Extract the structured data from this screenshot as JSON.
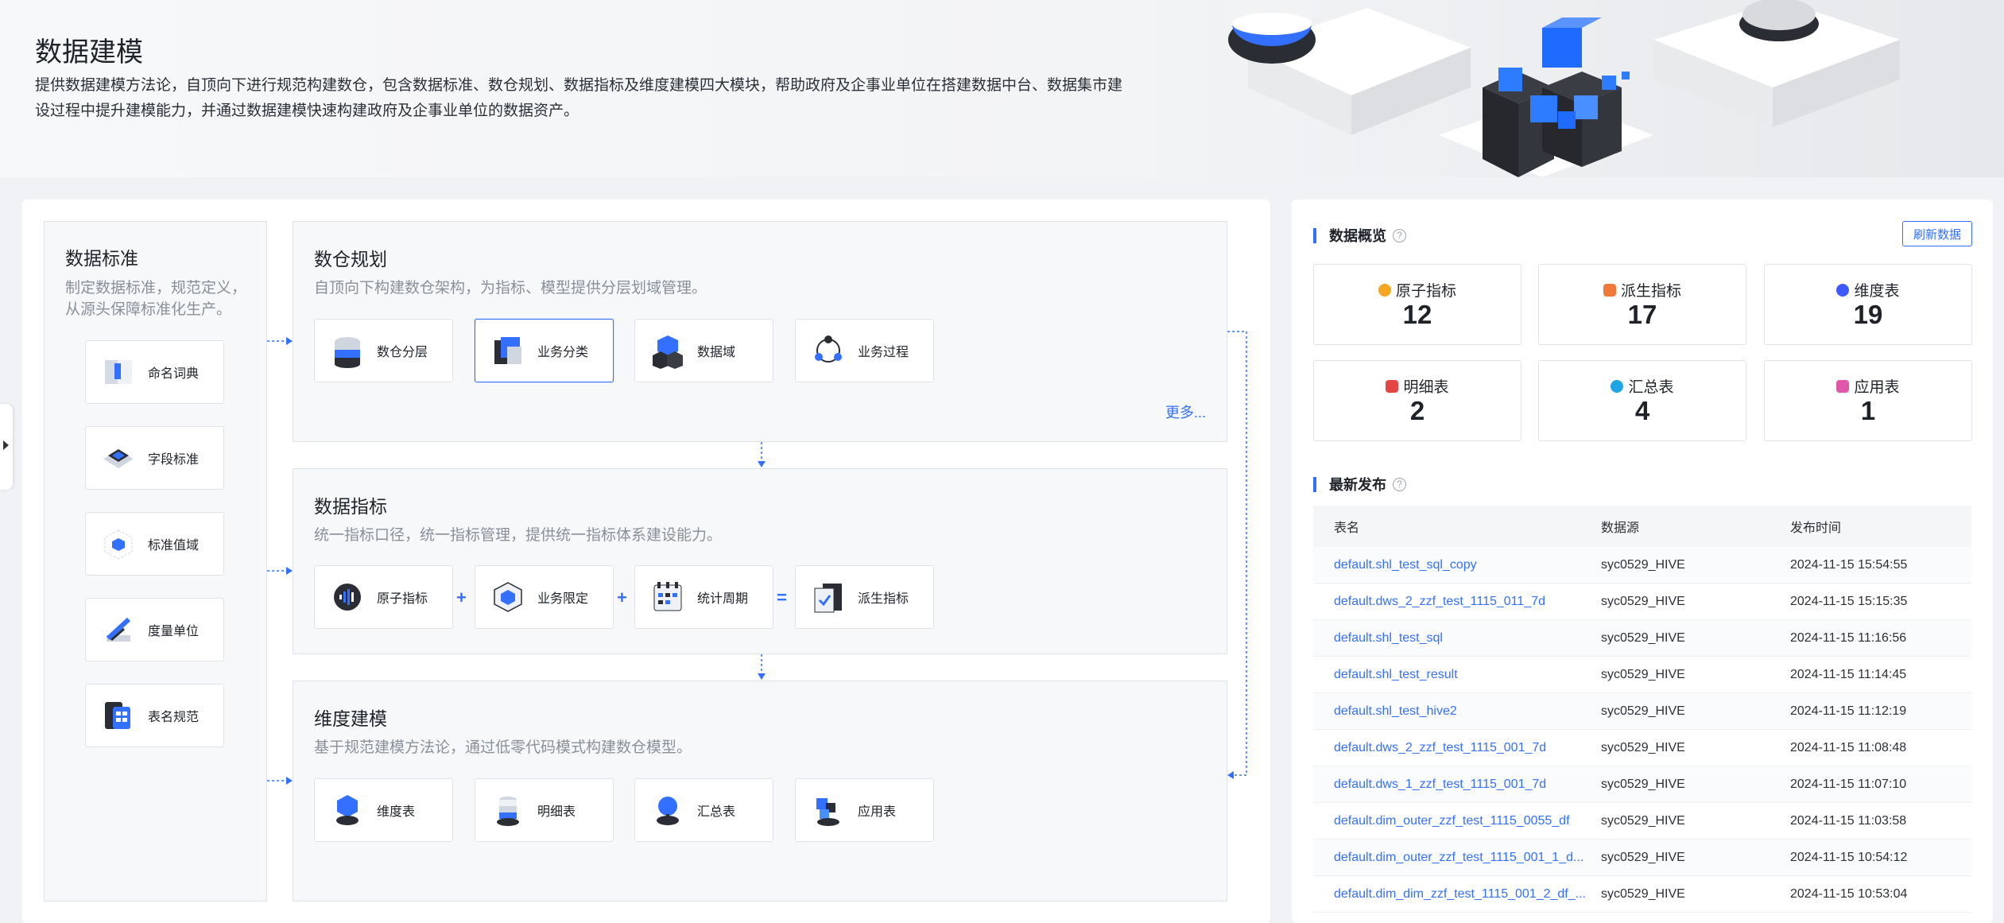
{
  "header": {
    "title": "数据建模",
    "description": "提供数据建模方法论，自顶向下进行规范构建数仓，包含数据标准、数仓规划、数据指标及维度建模四大模块，帮助政府及企事业单位在搭建数据中台、数据集市建设过程中提升建模能力，并通过数据建模快速构建政府及企事业单位的数据资产。"
  },
  "standards": {
    "title": "数据标准",
    "description": "制定数据标准，规范定义，从源头保障标准化生产。",
    "items": [
      {
        "label": "命名词典",
        "icon": "dictionary-icon"
      },
      {
        "label": "字段标准",
        "icon": "field-standard-icon"
      },
      {
        "label": "标准值域",
        "icon": "value-domain-icon"
      },
      {
        "label": "度量单位",
        "icon": "measure-unit-icon"
      },
      {
        "label": "表名规范",
        "icon": "table-naming-icon"
      }
    ]
  },
  "warehouse": {
    "title": "数仓规划",
    "description": "自顶向下构建数仓架构，为指标、模型提供分层划域管理。",
    "items": [
      {
        "label": "数仓分层",
        "icon": "layers-icon"
      },
      {
        "label": "业务分类",
        "icon": "business-category-icon"
      },
      {
        "label": "数据域",
        "icon": "data-domain-icon"
      },
      {
        "label": "业务过程",
        "icon": "business-process-icon"
      }
    ],
    "more": "更多..."
  },
  "metrics": {
    "title": "数据指标",
    "description": "统一指标口径，统一指标管理，提供统一指标体系建设能力。",
    "items": [
      {
        "label": "原子指标",
        "icon": "atomic-metric-icon"
      },
      {
        "label": "业务限定",
        "icon": "business-limit-icon"
      },
      {
        "label": "统计周期",
        "icon": "calendar-icon"
      },
      {
        "label": "派生指标",
        "icon": "derived-metric-icon"
      }
    ],
    "operators": [
      "+",
      "+",
      "="
    ]
  },
  "dimension": {
    "title": "维度建模",
    "description": "基于规范建模方法论，通过低零代码模式构建数仓模型。",
    "items": [
      {
        "label": "维度表",
        "icon": "dimension-table-icon"
      },
      {
        "label": "明细表",
        "icon": "detail-table-icon"
      },
      {
        "label": "汇总表",
        "icon": "summary-table-icon"
      },
      {
        "label": "应用表",
        "icon": "app-table-icon"
      }
    ]
  },
  "overview": {
    "title": "数据概览",
    "refresh_label": "刷新数据",
    "stats": [
      {
        "name": "原子指标",
        "value": "12",
        "color": "#f5a623"
      },
      {
        "name": "派生指标",
        "value": "17",
        "color": "#f0793a"
      },
      {
        "name": "维度表",
        "value": "19",
        "color": "#3d5afe"
      },
      {
        "name": "明细表",
        "value": "2",
        "color": "#e64545"
      },
      {
        "name": "汇总表",
        "value": "4",
        "color": "#1fa5e6"
      },
      {
        "name": "应用表",
        "value": "1",
        "color": "#e056a8"
      }
    ]
  },
  "latest": {
    "title": "最新发布",
    "columns": [
      "表名",
      "数据源",
      "发布时间"
    ],
    "rows": [
      [
        "default.shl_test_sql_copy",
        "syc0529_HIVE",
        "2024-11-15 15:54:55"
      ],
      [
        "default.dws_2_zzf_test_1115_011_7d",
        "syc0529_HIVE",
        "2024-11-15 15:15:35"
      ],
      [
        "default.shl_test_sql",
        "syc0529_HIVE",
        "2024-11-15 11:16:56"
      ],
      [
        "default.shl_test_result",
        "syc0529_HIVE",
        "2024-11-15 11:14:45"
      ],
      [
        "default.shl_test_hive2",
        "syc0529_HIVE",
        "2024-11-15 11:12:19"
      ],
      [
        "default.dws_2_zzf_test_1115_001_7d",
        "syc0529_HIVE",
        "2024-11-15 11:08:48"
      ],
      [
        "default.dws_1_zzf_test_1115_001_7d",
        "syc0529_HIVE",
        "2024-11-15 11:07:10"
      ],
      [
        "default.dim_outer_zzf_test_1115_0055_df",
        "syc0529_HIVE",
        "2024-11-15 11:03:58"
      ],
      [
        "default.dim_outer_zzf_test_1115_001_1_d...",
        "syc0529_HIVE",
        "2024-11-15 10:54:12"
      ],
      [
        "default.dim_dim_zzf_test_1115_001_2_df_...",
        "syc0529_HIVE",
        "2024-11-15 10:53:04"
      ]
    ]
  }
}
